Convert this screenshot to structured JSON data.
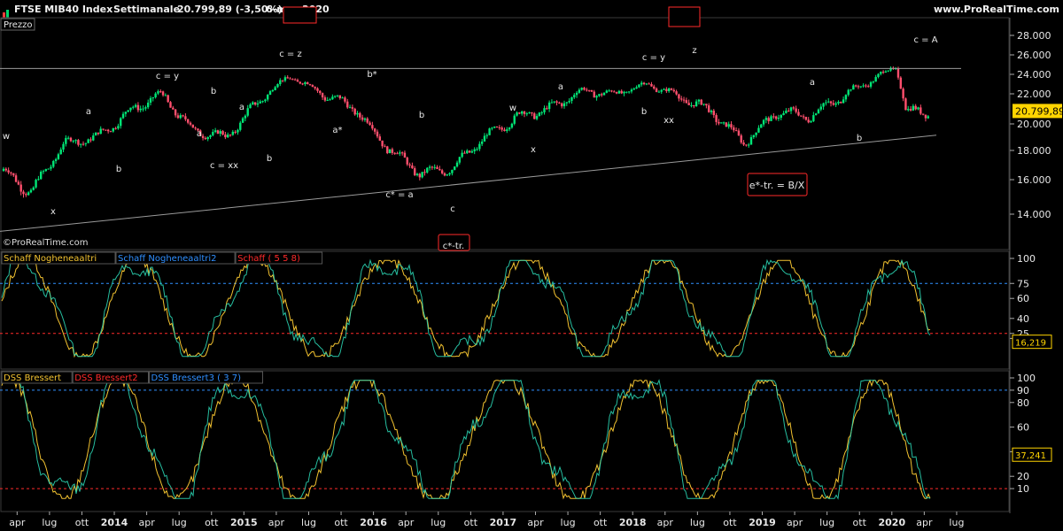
{
  "header": {
    "instrument": "FTSE MIB40 Index",
    "timeframe": "Settimanale",
    "last_change": "20.799,89 (-3,50%)",
    "date": "6-mar-2020",
    "website": "www.ProRealTime.com",
    "watermark": "©ProRealTime.com"
  },
  "colors": {
    "background": "#000000",
    "up_candle": "#00e676",
    "down_candle": "#ff4f6d",
    "schaff_line1": "#f2c230",
    "schaff_line2": "#2ad1b0",
    "level_blue": "#2f8fff",
    "level_red": "#ff2a2a",
    "price_tag": "#ffd400",
    "grid": "#222222"
  },
  "price_pane": {
    "label": "Prezzo",
    "last_price_tag": "20.799,89",
    "y_ticks": [
      "28.000",
      "26.000",
      "24.000",
      "22.000",
      "20.000",
      "18.000",
      "16.000",
      "14.000"
    ],
    "wave_labels": [
      "w",
      "x",
      "b",
      "a",
      "c = y",
      "a",
      "b",
      "c = xx",
      "a",
      "b",
      "c = z",
      "a*",
      "b*",
      "c* = a",
      "b",
      "c",
      "w",
      "x",
      "a",
      "b",
      "c = y",
      "xx",
      "z",
      "a",
      "b",
      "c = A"
    ],
    "boxed_labels": [
      "e*-tr. = B/X",
      "c*-tr."
    ]
  },
  "indicator1": {
    "names": [
      "Schaff Nogheneaaltri",
      "Schaff Nogheneaaltri2",
      "Schaff ( 5 5 8)"
    ],
    "y_ticks": [
      "100",
      "75",
      "60",
      "40",
      "25",
      "20"
    ],
    "last_value_tag": "16,219",
    "upper_level": 75,
    "lower_level": 25
  },
  "indicator2": {
    "names": [
      "DSS Bressert",
      "DSS Bressert2",
      "DSS Bressert3 ( 3 7)"
    ],
    "y_ticks": [
      "100",
      "90",
      "80",
      "60",
      "40",
      "20",
      "10"
    ],
    "last_value_tag": "37,241",
    "upper_level": 90,
    "lower_level": 10
  },
  "x_axis": {
    "labels": [
      "apr",
      "lug",
      "ott",
      "2014",
      "apr",
      "lug",
      "ott",
      "2015",
      "apr",
      "lug",
      "ott",
      "2016",
      "apr",
      "lug",
      "ott",
      "2017",
      "apr",
      "lug",
      "ott",
      "2018",
      "apr",
      "lug",
      "ott",
      "2019",
      "apr",
      "lug",
      "ott",
      "2020",
      "apr",
      "lug"
    ]
  },
  "chart_data": {
    "type": "candlestick",
    "title": "FTSE MIB40 Index",
    "series": [
      {
        "name": "FTSE MIB40 Index",
        "x": [
          "2013-03",
          "2013-06",
          "2013-09",
          "2013-12",
          "2014-03",
          "2014-06",
          "2014-09",
          "2014-12",
          "2015-03",
          "2015-06",
          "2015-09",
          "2015-12",
          "2016-03",
          "2016-06",
          "2016-09",
          "2016-12",
          "2017-03",
          "2017-06",
          "2017-09",
          "2017-12",
          "2018-03",
          "2018-06",
          "2018-09",
          "2018-12",
          "2019-03",
          "2019-06",
          "2019-09",
          "2019-12",
          "2020-02",
          "2020-03"
        ],
        "values": [
          16800,
          15200,
          18500,
          19000,
          20800,
          22000,
          19500,
          19000,
          21500,
          23800,
          22000,
          21000,
          18200,
          16400,
          16800,
          19000,
          20500,
          21000,
          22300,
          22000,
          23000,
          21800,
          20800,
          18600,
          20800,
          20500,
          21800,
          23500,
          24800,
          20800
        ]
      }
    ],
    "trendlines": [
      {
        "name": "resistance",
        "y": 24600
      },
      {
        "name": "support",
        "from": [
          "2013-03",
          13000
        ],
        "to": [
          "2020-03",
          19150
        ]
      }
    ],
    "indicators": {
      "schaff": {
        "levels": [
          75,
          25
        ],
        "last": 16.219
      },
      "dss_bressert": {
        "levels": [
          90,
          10
        ],
        "last": 37.241
      }
    },
    "ylim": [
      12800,
      29000
    ]
  }
}
